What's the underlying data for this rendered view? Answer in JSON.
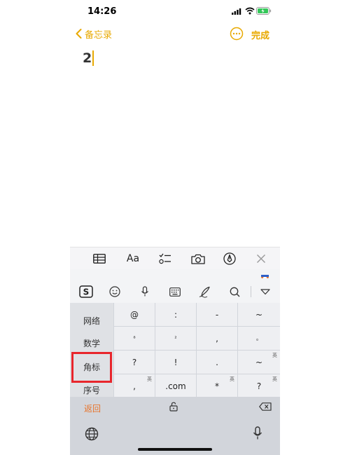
{
  "status": {
    "time": "14:26"
  },
  "nav": {
    "back_label": "备忘录",
    "done_label": "完成"
  },
  "note": {
    "text": "2"
  },
  "format_toolbar": {
    "items": [
      "table-icon",
      "Aa",
      "checklist-icon",
      "camera-icon",
      "markup-pen-icon",
      "close-icon"
    ]
  },
  "keyboard": {
    "tools": [
      "sogou-logo-icon",
      "emoji-icon",
      "mic-icon",
      "keyboard-icon",
      "handwriting-icon",
      "search-icon",
      "collapse-icon"
    ],
    "categories": [
      "网络",
      "数学",
      "角标",
      "序号"
    ],
    "selected_category": "角标",
    "keys": [
      [
        "@",
        ":",
        "-",
        "~"
      ],
      [
        "⁸",
        "²",
        ",",
        "。"
      ],
      [
        "?",
        "!",
        ".",
        "~"
      ],
      [
        ",",
        ".com",
        "*",
        "?"
      ]
    ],
    "key_badges": {
      "row3_col4": "英",
      "row4_col1": "英",
      "row4_col3": "英",
      "row4_col4": "英"
    },
    "return_label": "返回"
  },
  "colors": {
    "accent": "#E8A900",
    "highlight_box": "#E8262C",
    "return_text": "#E8742C"
  }
}
